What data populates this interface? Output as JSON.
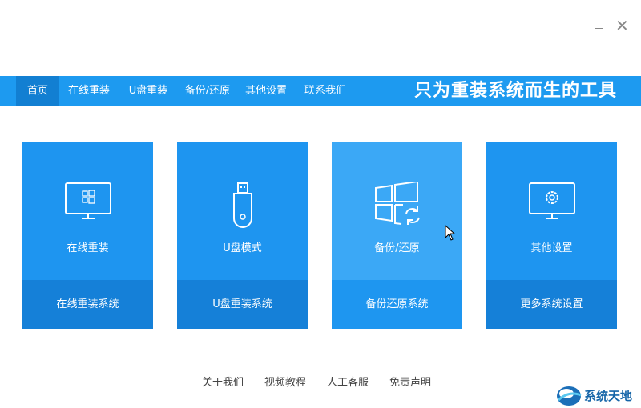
{
  "window": {
    "minimize_icon": "minimize-icon",
    "close_glyph": "✕"
  },
  "nav": {
    "items": [
      {
        "label": "首页",
        "active": true
      },
      {
        "label": "在线重装"
      },
      {
        "label": "U盘重装"
      },
      {
        "label": "备份/还原"
      },
      {
        "label": "其他设置"
      },
      {
        "label": "联系我们"
      }
    ],
    "slogan": "只为重装系统而生的工具"
  },
  "cards": [
    {
      "title": "在线重装",
      "subtitle": "在线重装系统",
      "icon": "monitor-windows-icon"
    },
    {
      "title": "U盘模式",
      "subtitle": "U盘重装系统",
      "icon": "usb-drive-icon"
    },
    {
      "title": "备份/还原",
      "subtitle": "备份还原系统",
      "icon": "windows-restore-icon"
    },
    {
      "title": "其他设置",
      "subtitle": "更多系统设置",
      "icon": "monitor-gear-icon"
    }
  ],
  "footer": {
    "links": [
      "关于我们",
      "视频教程",
      "人工客服",
      "免责声明"
    ]
  },
  "watermark": {
    "text": "系统天地",
    "icon": "watermark-logo-icon"
  },
  "colors": {
    "nav_bg": "#1d9af0",
    "nav_active": "#127fd2",
    "card_top": "#1e95f0",
    "card_bottom": "#1580d8",
    "card_hover_top": "#3ba8f6"
  }
}
